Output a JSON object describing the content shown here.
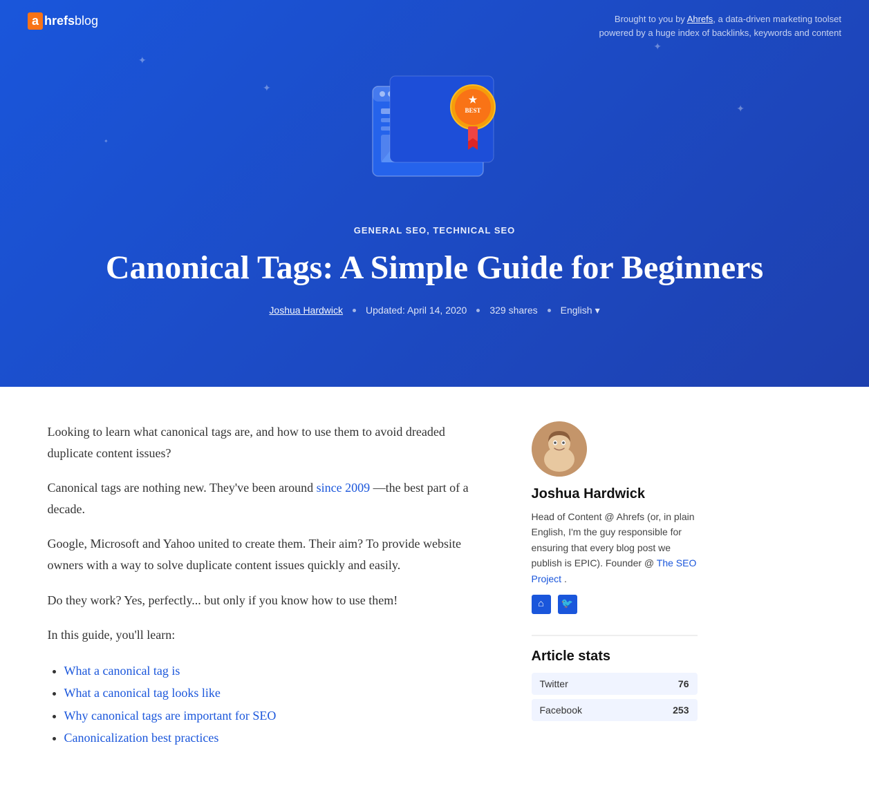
{
  "header": {
    "logo_a": "a",
    "logo_brand": "hrefs",
    "logo_blog": "blog",
    "tagline": "Brought to you by Ahrefs, a data-driven marketing toolset powered by a huge index of backlinks, keywords and content",
    "tagline_link": "Ahrefs"
  },
  "hero": {
    "categories": "GENERAL SEO, TECHNICAL SEO",
    "title": "Canonical Tags: A Simple Guide for Beginners",
    "author": "Joshua Hardwick",
    "updated": "Updated: April 14, 2020",
    "shares": "329 shares",
    "language": "English"
  },
  "article": {
    "intro": "Looking to learn what canonical tags are, and how to use them to avoid dreaded duplicate content issues?",
    "p1": "Canonical tags are nothing new. They've been around",
    "p1_link_text": "since 2009",
    "p1_cont": "—the best part of a decade.",
    "p2": "Google, Microsoft and Yahoo united to create them. Their aim? To provide website owners with a way to solve duplicate content issues quickly and easily.",
    "p3": "Do they work? Yes, perfectly... but only if you know how to use them!",
    "p4": "In this guide, you'll learn:",
    "toc": [
      "What a canonical tag is",
      "What a canonical tag looks like",
      "Why canonical tags are important for SEO",
      "Canonicalization best practices"
    ]
  },
  "sidebar": {
    "author_name": "Joshua Hardwick",
    "author_bio": "Head of Content @ Ahrefs (or, in plain English, I'm the guy responsible for ensuring that every blog post we publish is EPIC). Founder @",
    "author_project": "The SEO Project",
    "author_project_suffix": ".",
    "stats_title": "Article stats",
    "stats": [
      {
        "label": "Twitter",
        "value": "76"
      },
      {
        "label": "Facebook",
        "value": "253"
      }
    ]
  }
}
